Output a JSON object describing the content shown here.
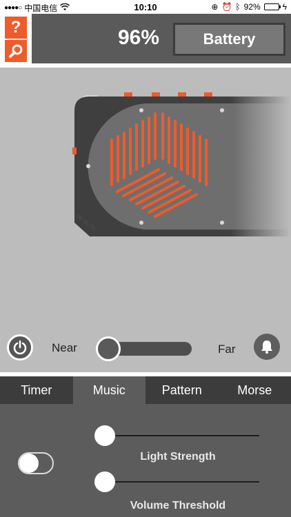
{
  "status_bar": {
    "signal": "●●●●○",
    "carrier": "中国电信",
    "time": "10:10",
    "battery_percent": "92%"
  },
  "header": {
    "help_icon_text": "?",
    "battery_value": "96%",
    "battery_button_label": "Battery"
  },
  "proximity": {
    "near_label": "Near",
    "far_label": "Far",
    "level": 0
  },
  "tabs": [
    {
      "label": "Timer",
      "active": false
    },
    {
      "label": "Music",
      "active": true
    },
    {
      "label": "Pattern",
      "active": false
    },
    {
      "label": "Morse",
      "active": false
    }
  ],
  "music": {
    "toggle_on": false,
    "light_strength_label": "Light Strength",
    "light_strength_value": 0,
    "volume_threshold_label": "Volume Threshold",
    "volume_threshold_value": 0
  },
  "colors": {
    "accent": "#ef5b2b",
    "dark_gray": "#5a5a5a",
    "device_bg": "#bcbcbc"
  }
}
